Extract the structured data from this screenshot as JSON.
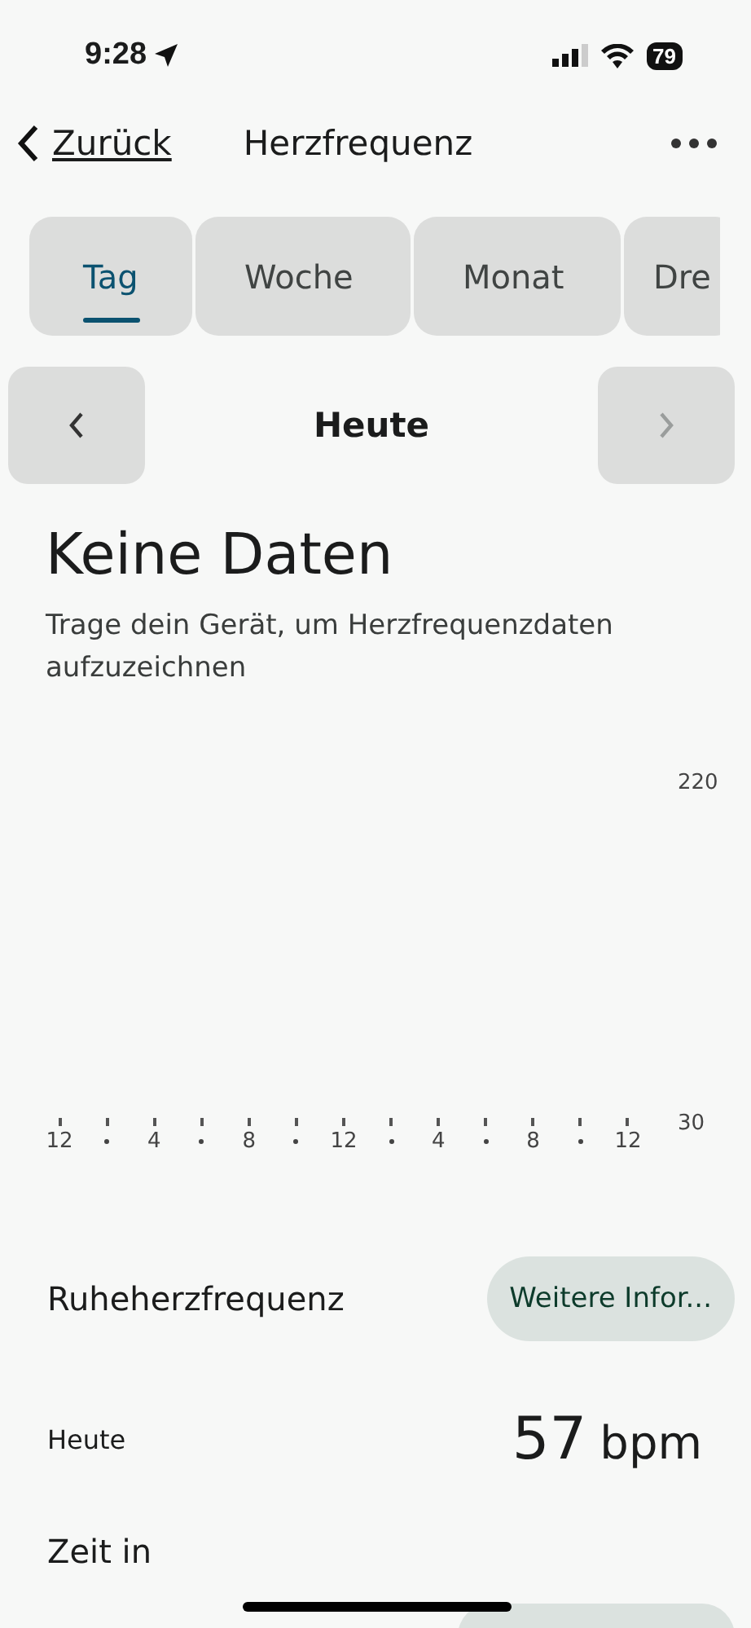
{
  "status_bar": {
    "time": "9:28",
    "battery": "79"
  },
  "nav": {
    "back": "Zurück",
    "title": "Herzfrequenz"
  },
  "tabs": [
    {
      "label": "Tag",
      "selected": true
    },
    {
      "label": "Woche",
      "selected": false
    },
    {
      "label": "Monat",
      "selected": false
    },
    {
      "label": "Dre",
      "selected": false
    }
  ],
  "period": {
    "label": "Heute",
    "prev_disabled": false,
    "next_disabled": true
  },
  "empty": {
    "title": "Keine Daten",
    "text": "Trage dein Gerät, um Herzfrequenzdaten aufzuzeichnen"
  },
  "chart_axis": {
    "y_labels": [
      "220",
      "30"
    ],
    "x_labels": [
      "12",
      "4",
      "8",
      "12",
      "4",
      "8",
      "12"
    ]
  },
  "resting": {
    "title": "Ruheherzfrequenz",
    "button": "Weitere Infor...",
    "row_label": "Heute",
    "value": "57",
    "unit": "bpm"
  },
  "next_section": {
    "title": "Zeit in"
  }
}
